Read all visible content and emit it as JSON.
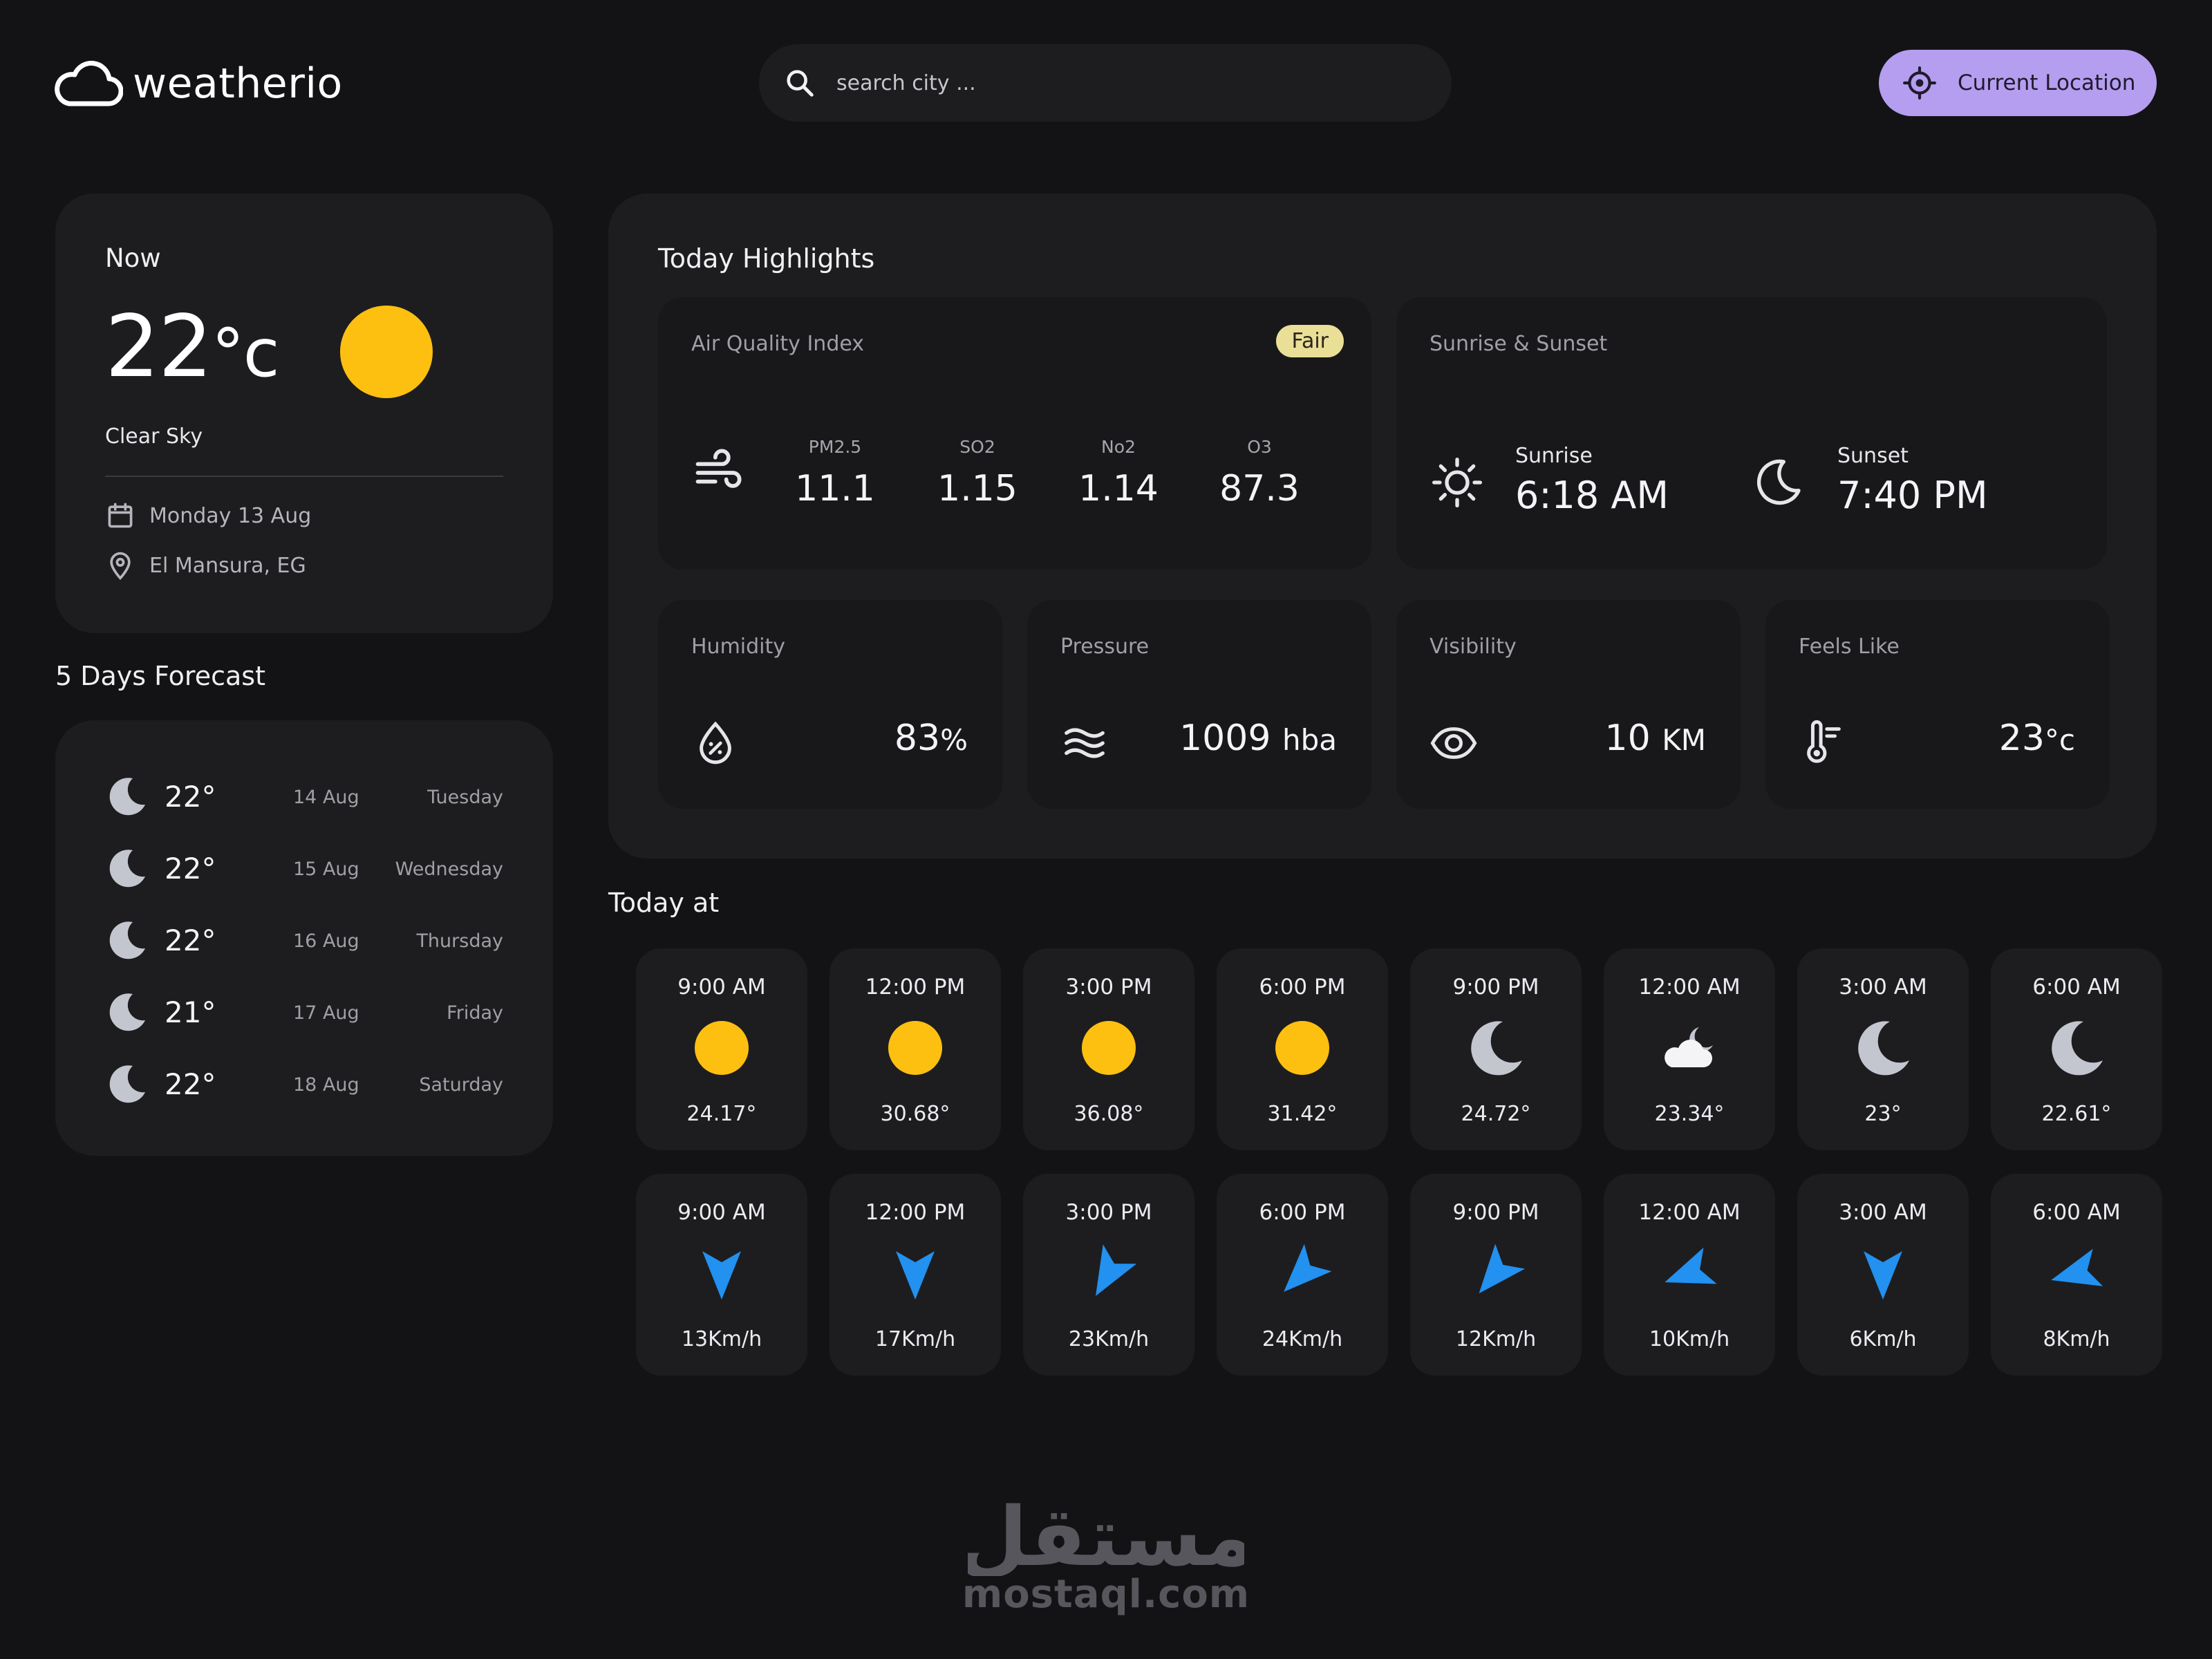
{
  "app": {
    "name": "weatherio"
  },
  "search": {
    "placeholder": "search city ..."
  },
  "location_button": {
    "label": "Current Location"
  },
  "now": {
    "label": "Now",
    "temp": "22",
    "unit": "°c",
    "description": "Clear Sky",
    "icon": "sun-icon",
    "date": "Monday 13 Aug",
    "location": "El Mansura, EG"
  },
  "forecast": {
    "title": "5 Days Forecast",
    "days": [
      {
        "icon": "moon-icon",
        "temp": "22°",
        "date": "14 Aug",
        "day": "Tuesday"
      },
      {
        "icon": "moon-icon",
        "temp": "22°",
        "date": "15 Aug",
        "day": "Wednesday"
      },
      {
        "icon": "moon-icon",
        "temp": "22°",
        "date": "16 Aug",
        "day": "Thursday"
      },
      {
        "icon": "moon-icon",
        "temp": "21°",
        "date": "17 Aug",
        "day": "Friday"
      },
      {
        "icon": "moon-icon",
        "temp": "22°",
        "date": "18 Aug",
        "day": "Saturday"
      }
    ]
  },
  "highlights": {
    "title": "Today Highlights",
    "aqi": {
      "label": "Air Quality Index",
      "badge": "Fair",
      "items": [
        {
          "key": "PM2.5",
          "value": "11.1"
        },
        {
          "key": "SO2",
          "value": "1.15"
        },
        {
          "key": "No2",
          "value": "1.14"
        },
        {
          "key": "O3",
          "value": "87.3"
        }
      ]
    },
    "sun": {
      "label": "Sunrise & Sunset",
      "sunrise_label": "Sunrise",
      "sunrise": "6:18 AM",
      "sunset_label": "Sunset",
      "sunset": "7:40 PM"
    },
    "humidity": {
      "label": "Humidity",
      "value": "83",
      "unit": "%"
    },
    "pressure": {
      "label": "Pressure",
      "value": "1009",
      "unit": "hba"
    },
    "visibility": {
      "label": "Visibility",
      "value": "10",
      "unit": "KM"
    },
    "feels_like": {
      "label": "Feels Like",
      "value": "23",
      "unit": "°c"
    }
  },
  "today": {
    "title": "Today at",
    "temps": [
      {
        "time": "9:00 AM",
        "icon": "sun-icon",
        "value": "24.17°"
      },
      {
        "time": "12:00 PM",
        "icon": "sun-icon",
        "value": "30.68°"
      },
      {
        "time": "3:00 PM",
        "icon": "sun-icon",
        "value": "36.08°"
      },
      {
        "time": "6:00 PM",
        "icon": "sun-icon",
        "value": "31.42°"
      },
      {
        "time": "9:00 PM",
        "icon": "moon-icon",
        "value": "24.72°"
      },
      {
        "time": "12:00 AM",
        "icon": "cloud-moon-icon",
        "value": "23.34°"
      },
      {
        "time": "3:00 AM",
        "icon": "moon-icon",
        "value": "23°"
      },
      {
        "time": "6:00 AM",
        "icon": "moon-icon",
        "value": "22.61°"
      }
    ],
    "winds": [
      {
        "time": "9:00 AM",
        "direction_deg": 180,
        "value": "13Km/h"
      },
      {
        "time": "12:00 PM",
        "direction_deg": 180,
        "value": "17Km/h"
      },
      {
        "time": "3:00 PM",
        "direction_deg": 210,
        "value": "23Km/h"
      },
      {
        "time": "6:00 PM",
        "direction_deg": 225,
        "value": "24Km/h"
      },
      {
        "time": "9:00 PM",
        "direction_deg": 220,
        "value": "12Km/h"
      },
      {
        "time": "12:00 AM",
        "direction_deg": 250,
        "value": "10Km/h"
      },
      {
        "time": "3:00 AM",
        "direction_deg": 180,
        "value": "6Km/h"
      },
      {
        "time": "6:00 AM",
        "direction_deg": 255,
        "value": "8Km/h"
      }
    ]
  },
  "watermark": {
    "arabic": "مستقل",
    "text": "mostaql.com"
  },
  "colors": {
    "background": "#131315",
    "card": "#1d1d20",
    "accent": "#b59ef0",
    "sun": "#fec010",
    "moon": "#c3c6cf",
    "wind_arrow": "#2291f0",
    "badge": "#eadf97"
  }
}
